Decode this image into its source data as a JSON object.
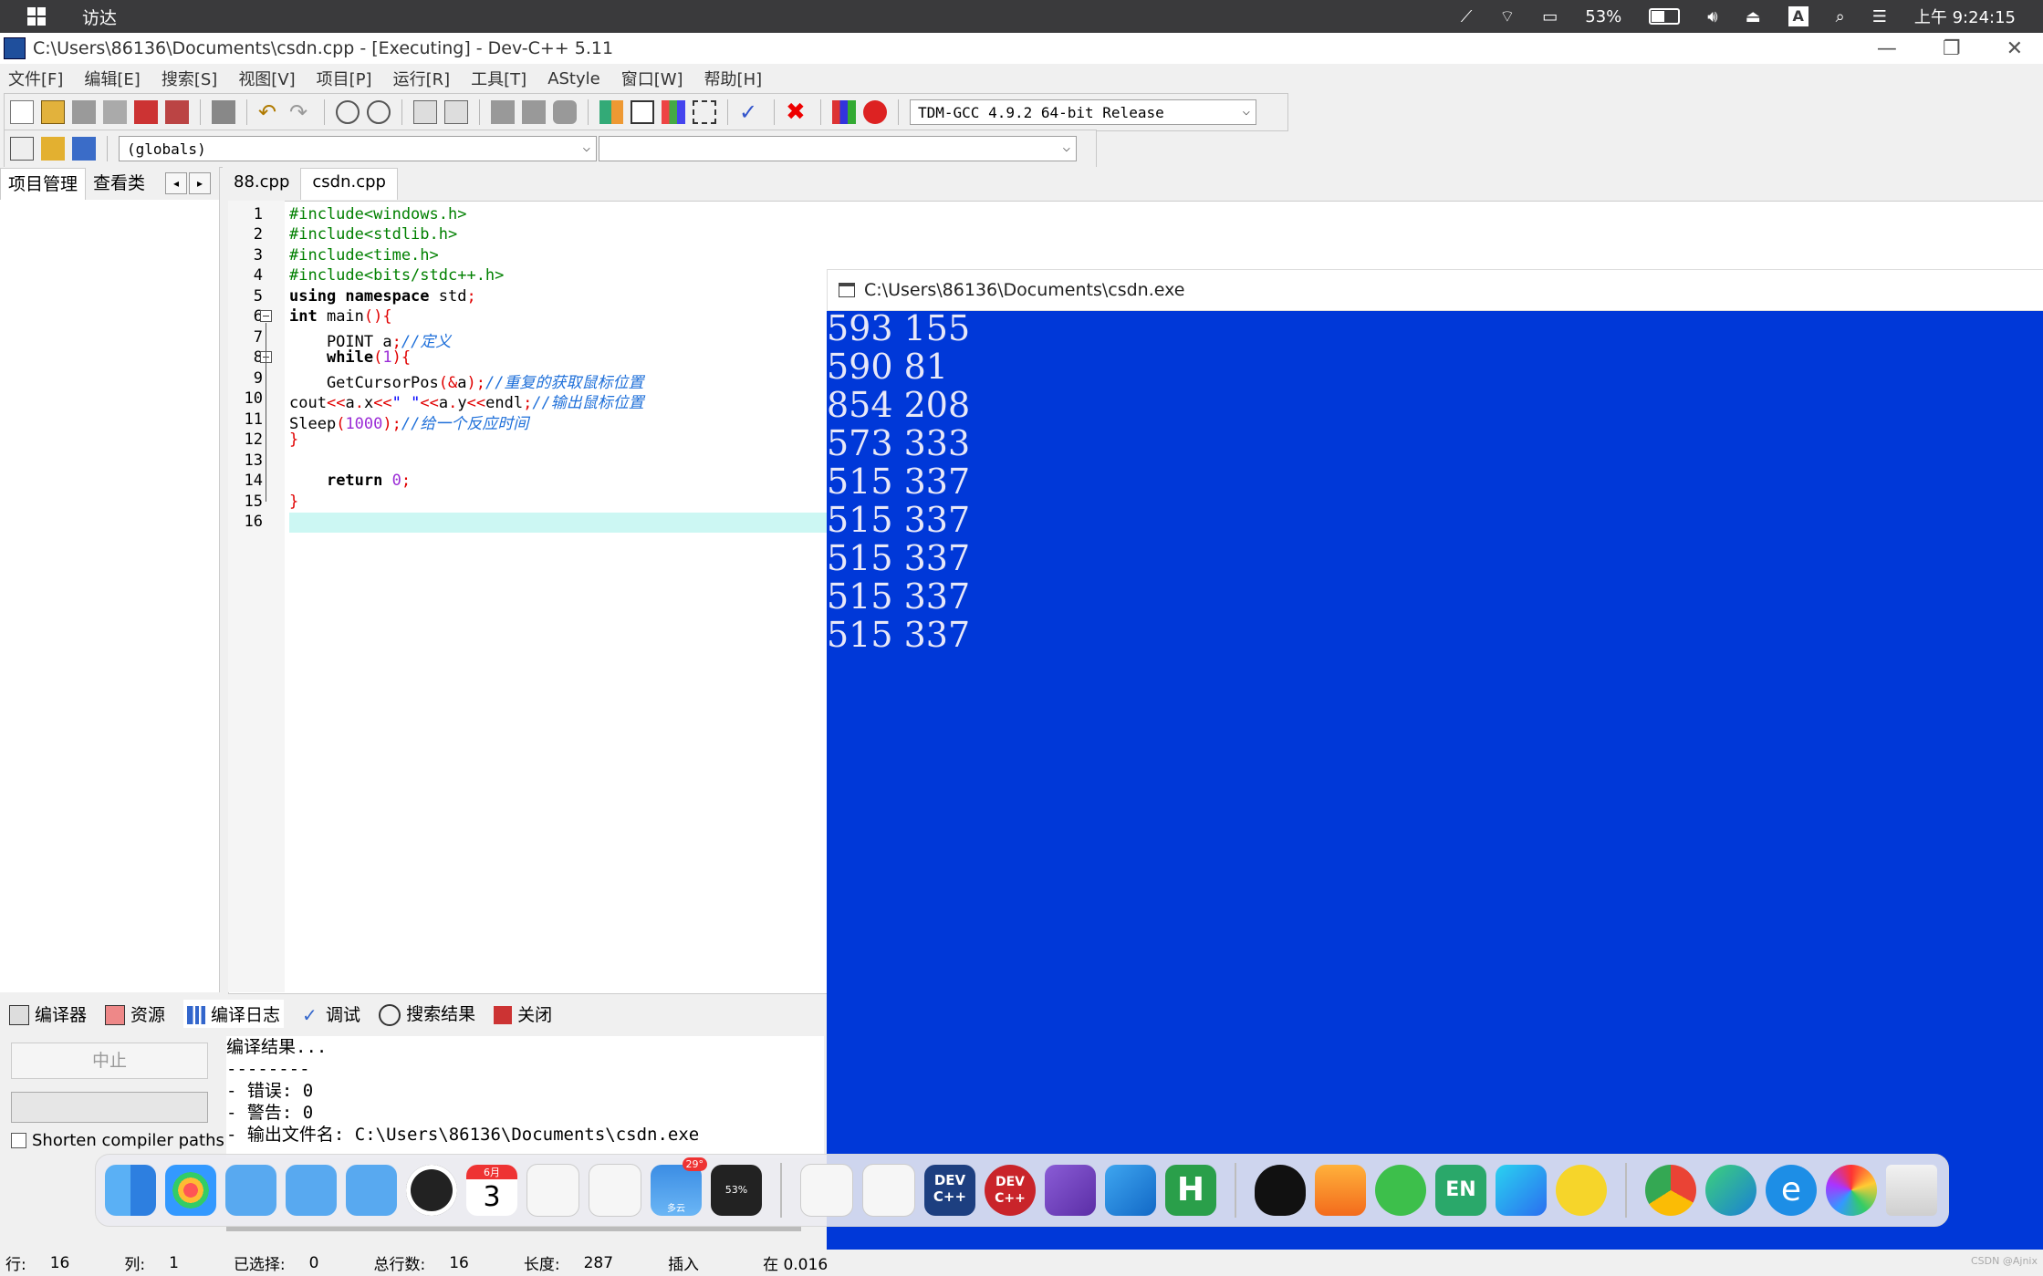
{
  "macbar": {
    "app_name": "访达",
    "battery": "53%",
    "clock": "上午 9:24:15"
  },
  "window": {
    "title": "C:\\Users\\86136\\Documents\\csdn.cpp - [Executing] - Dev-C++ 5.11",
    "minimize": "—",
    "maximize": "❐",
    "close": "✕"
  },
  "menu": [
    "文件[F]",
    "编辑[E]",
    "搜索[S]",
    "视图[V]",
    "项目[P]",
    "运行[R]",
    "工具[T]",
    "AStyle",
    "窗口[W]",
    "帮助[H]"
  ],
  "toolbar": {
    "compiler": "TDM-GCC 4.9.2 64-bit Release",
    "scope": "(globals)",
    "member": ""
  },
  "left_tabs": [
    "项目管理",
    "查看类"
  ],
  "editor_tabs": [
    "88.cpp",
    "csdn.cpp"
  ],
  "editor": {
    "line_numbers": [
      "1",
      "2",
      "3",
      "4",
      "5",
      "6",
      "7",
      "8",
      "9",
      "10",
      "11",
      "12",
      "13",
      "14",
      "15",
      "16"
    ]
  },
  "bottom_tabs": [
    "编译器",
    "资源",
    "编译日志",
    "调试",
    "搜索结果",
    "关闭"
  ],
  "bottom": {
    "stop_label": "中止",
    "shorten_label": "Shorten compiler paths",
    "log": "编译结果...\n--------\n- 错误: 0\n- 警告: 0\n- 输出文件名: C:\\Users\\86136\\Documents\\csdn.exe"
  },
  "status": {
    "row_label": "行:",
    "row_value": "16",
    "col_label": "列:",
    "col_value": "1",
    "selected_label": "已选择:",
    "selected_value": "0",
    "total_label": "总行数:",
    "total_value": "16",
    "length_label": "长度:",
    "length_value": "287",
    "mode": "插入",
    "parse": "在 0.016"
  },
  "console": {
    "title": "C:\\Users\\86136\\Documents\\csdn.exe",
    "lines": [
      "593 155",
      "590 81",
      "854 208",
      "573 333",
      "515 337",
      "515 337",
      "515 337",
      "515 337",
      "515 337"
    ]
  },
  "dock": {
    "calendar_month": "6月",
    "calendar_day": "3",
    "weather_badge": "29°",
    "weather_label": "多云",
    "battery_widget": "53%",
    "devcpp_label": "DEV C++",
    "devcpp2_label": "DEV C++",
    "en_label": "EN"
  },
  "watermark": "CSDN @Ajnix"
}
